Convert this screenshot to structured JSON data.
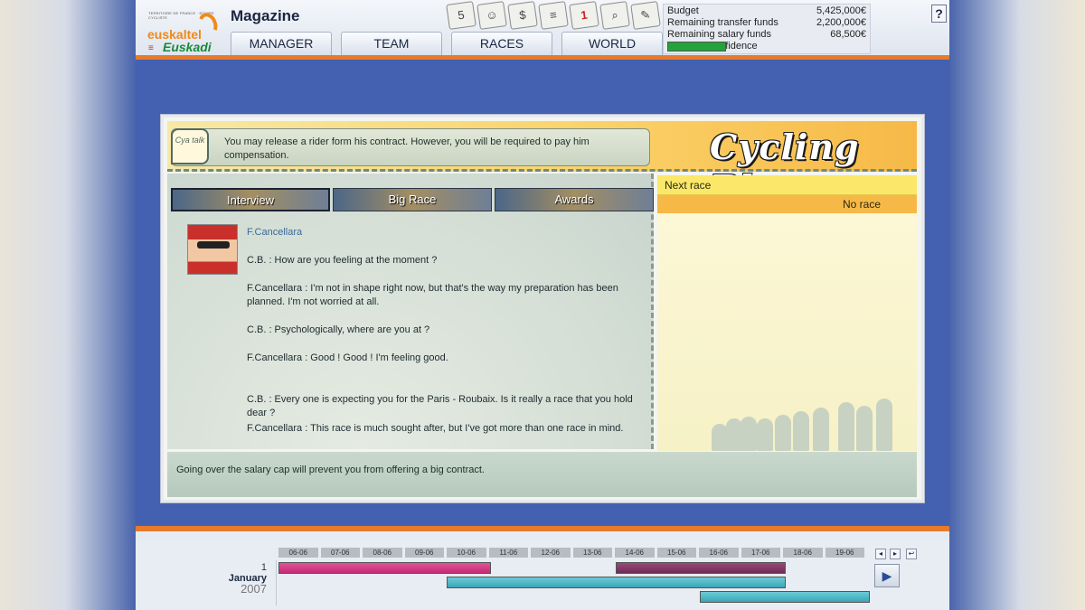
{
  "header": {
    "section_title": "Magazine",
    "logo": {
      "tagline": "TERRITOIRE DE FRANCE · EQUIPE CYCLISTE",
      "brand1": "euskaltel",
      "brand2": "Euskadi"
    },
    "nav": [
      {
        "label": "MANAGER"
      },
      {
        "label": "TEAM"
      },
      {
        "label": "RACES"
      },
      {
        "label": "WORLD"
      }
    ],
    "toolbar": [
      {
        "icon": "calendar-5-icon",
        "glyph": "5"
      },
      {
        "icon": "rider-icon",
        "glyph": "☺"
      },
      {
        "icon": "money-icon",
        "glyph": "$"
      },
      {
        "icon": "document-icon",
        "glyph": "≡"
      },
      {
        "icon": "mail-icon",
        "glyph": "1"
      },
      {
        "icon": "magnifier-icon",
        "glyph": "⌕"
      },
      {
        "icon": "notepad-icon",
        "glyph": "✎"
      }
    ],
    "stats": {
      "budget_label": "Budget",
      "budget_value": "5,425,000€",
      "transfer_label": "Remaining transfer funds",
      "transfer_value": "2,200,000€",
      "salary_label": "Remaining salary funds",
      "salary_value": "68,500€",
      "sponsor_label": "Sponsor Confidence",
      "sponsor_color": "#23a33a"
    },
    "help_label": "?"
  },
  "blog": {
    "talk_label": "Cya talk",
    "tip": "You may release a rider form his contract. However, you will be required to pay him compensation.",
    "title": "Cycling Blog",
    "tabs": [
      {
        "label": "Interview"
      },
      {
        "label": "Big Race"
      },
      {
        "label": "Awards"
      }
    ],
    "interview": {
      "name": "F.Cancellara",
      "lines": [
        "C.B. : How are you feeling at the moment ?",
        "F.Cancellara : I'm not in shape right now, but that's the way my preparation has been planned. I'm not worried at all.",
        "C.B. : Psychologically, where are you at ?",
        "F.Cancellara : Good ! Good ! I'm feeling good.",
        "C.B. : Every one is expecting you for the Paris - Roubaix. Is it really a race that you hold dear ?",
        "F.Cancellara : This race is much sought after, but I've got more than one race in mind."
      ]
    },
    "next_race_label": "Next race",
    "next_race_value": "No race",
    "footer_tip": "Going over the salary cap will prevent you from offering a big contract."
  },
  "timeline": {
    "day": "1",
    "month": "January",
    "year": "2007",
    "days": [
      "06-06",
      "07-06",
      "08-06",
      "09-06",
      "10-06",
      "11-06",
      "12-06",
      "13-06",
      "14-06",
      "15-06",
      "16-06",
      "17-06",
      "18-06",
      "19-06"
    ],
    "controls": [
      "◂",
      "▸",
      "↩"
    ],
    "play_label": "▶"
  }
}
